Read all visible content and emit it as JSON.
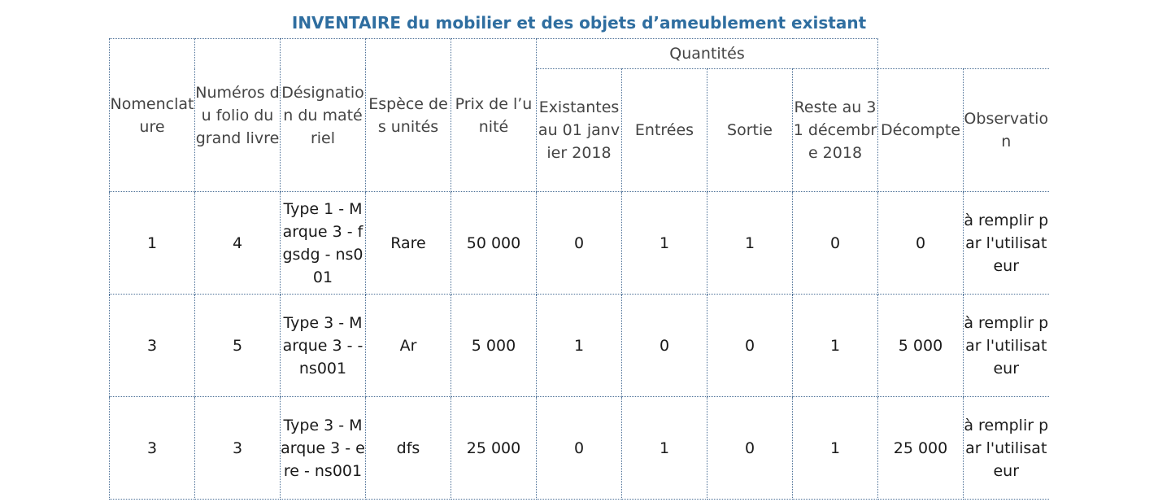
{
  "title": {
    "bold": "INVENTAIRE",
    "rest": " du mobilier et des objets d’ameublement existant"
  },
  "headers": {
    "nomenclature": "Nomenclature",
    "folio": "Numéros du folio du grand livre",
    "designation": "Désignation du matériel",
    "espece": "Espèce des unités",
    "prix": "Prix de l’unité",
    "quantites": "Quantités",
    "existants": "Existantes au 01 janvier 2018",
    "entrees": "Entrées",
    "sortie": "Sortie",
    "reste": "Reste au 31 décembre 2018",
    "decompte": "Décompte",
    "observation": "Observation"
  },
  "rows": [
    {
      "nomenclature": "1",
      "folio": "4",
      "designation": "Type 1 - Marque 3 - fgsdg - ns001",
      "espece": "Rare",
      "prix": "50 000",
      "existants": "0",
      "entrees": "1",
      "sortie": "1",
      "reste": "0",
      "decompte": "0",
      "observation": "à remplir par l'utilisateur"
    },
    {
      "nomenclature": "3",
      "folio": "5",
      "designation": "Type 3 - Marque 3 - - ns001",
      "espece": "Ar",
      "prix": "5 000",
      "existants": "1",
      "entrees": "0",
      "sortie": "0",
      "reste": "1",
      "decompte": "5 000",
      "observation": "à remplir par l'utilisateur"
    },
    {
      "nomenclature": "3",
      "folio": "3",
      "designation": "Type 3 - Marque 3 - ere - ns001",
      "espece": "dfs",
      "prix": "25 000",
      "existants": "0",
      "entrees": "1",
      "sortie": "0",
      "reste": "1",
      "decompte": "25 000",
      "observation": "à remplir par l'utilisateur"
    }
  ]
}
